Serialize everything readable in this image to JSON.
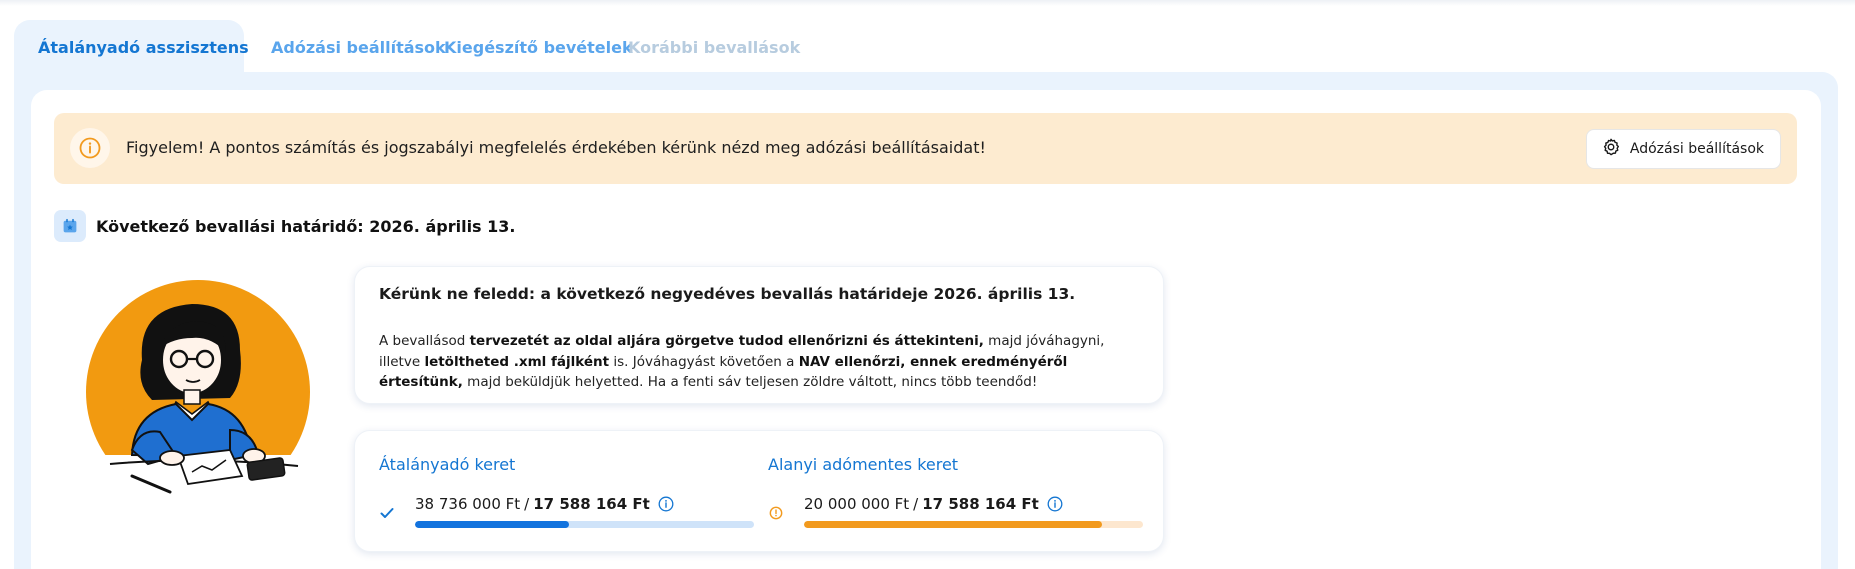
{
  "tabs": [
    {
      "label": "Átalányadó asszisztens",
      "active": true
    },
    {
      "label": "Adózási beállítások",
      "active": false
    },
    {
      "label": "Kiegészítő bevételek",
      "active": false
    },
    {
      "label": "Korábbi bevallások",
      "active": false,
      "disabled": true
    }
  ],
  "alert": {
    "icon": "info-icon",
    "text": "Figyelem! A pontos számítás és jogszabályi megfelelés érdekében kérünk nézd meg adózási beállításaidat!",
    "button_label": "Adózási beállítások",
    "button_icon": "gear-icon"
  },
  "deadline": {
    "icon": "calendar-icon",
    "text": "Következő bevallási határidő: 2026. április 13."
  },
  "message": {
    "title": "Kérünk ne feledd: a következő negyedéves bevallás határideje 2026. április 13.",
    "body_parts": [
      {
        "t": "A bevallásod ",
        "b": false
      },
      {
        "t": "tervezetét az oldal aljára görgetve tudod ellenőrizni és áttekinteni,",
        "b": true
      },
      {
        "t": " majd jóváhagyni, illetve ",
        "b": false
      },
      {
        "t": "letöltheted .xml fájlként",
        "b": true
      },
      {
        "t": " is. Jóváhagyást követően a ",
        "b": false
      },
      {
        "t": "NAV ellenőrzi, ennek eredményéről értesítünk,",
        "b": true
      },
      {
        "t": " majd beküldjük helyetted. Ha a fenti sáv teljesen zöldre váltott, nincs több teendőd!",
        "b": false
      }
    ]
  },
  "limits": [
    {
      "title": "Átalányadó keret",
      "status_icon": "check-icon",
      "used": "38 736 000 Ft",
      "separator": " / ",
      "total": "17 588 164 Ft",
      "progress": 0.455,
      "color": "#1273de"
    },
    {
      "title": "Alanyi adómentes keret",
      "status_icon": "warning-icon",
      "used": "20 000 000 Ft",
      "separator": " / ",
      "total": "17 588 164 Ft",
      "progress": 0.88,
      "color": "#f29a1e"
    }
  ],
  "colors": {
    "accent": "#1476d2",
    "alert_bg": "#fdebd0",
    "warning": "#f29a1e",
    "panel_bg": "#eaf3fd"
  }
}
